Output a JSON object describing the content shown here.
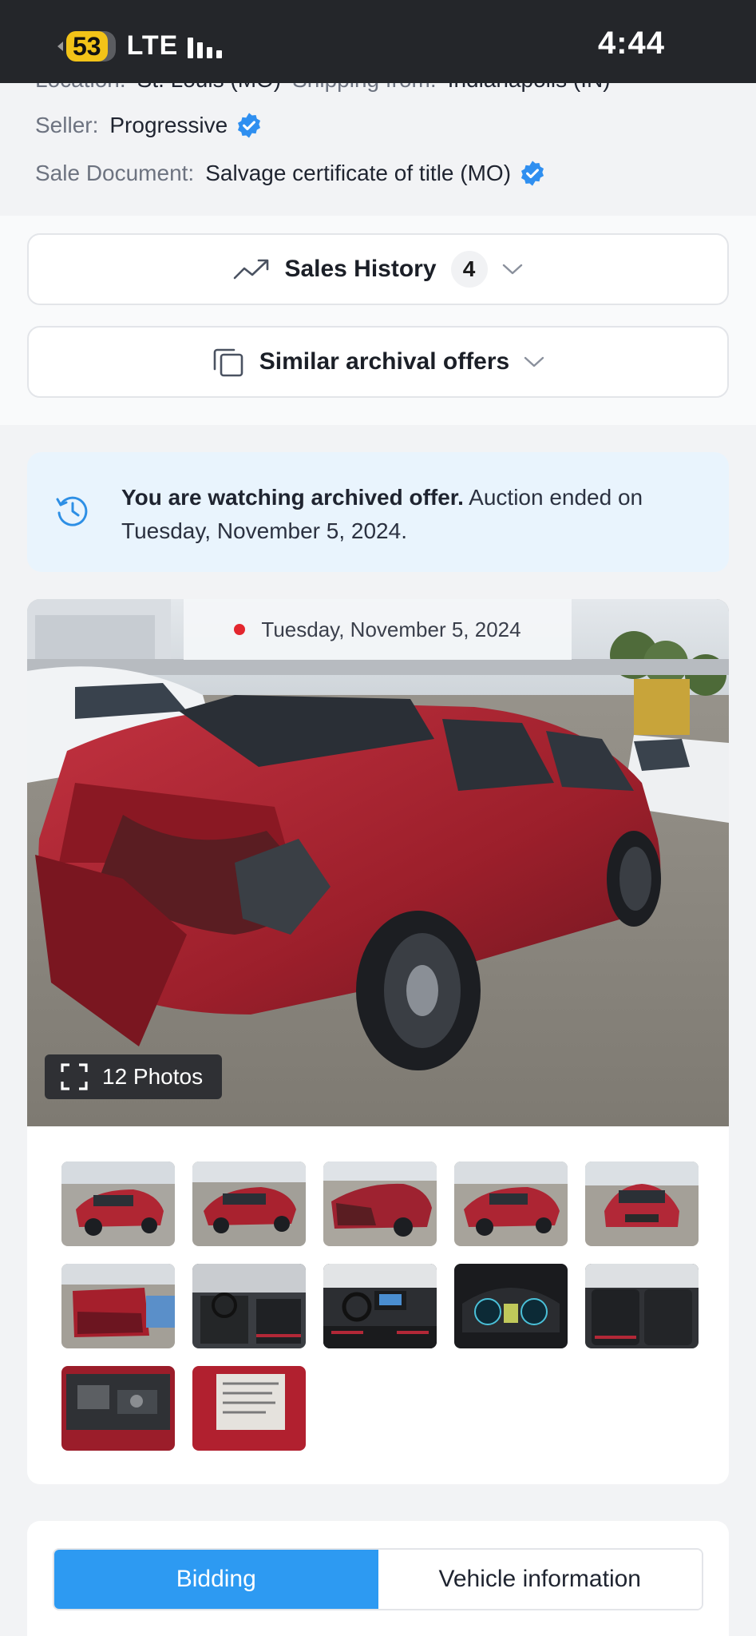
{
  "status_bar": {
    "battery": "53",
    "network": "LTE",
    "time": "4:44"
  },
  "listing": {
    "location_label": "Location:",
    "location_value": "St. Louis (MO)",
    "shipping_label": "Shipping from:",
    "shipping_value": "Indianapolis (IN)",
    "seller_label": "Seller:",
    "seller_value": "Progressive",
    "sale_document_label": "Sale Document:",
    "sale_document_value": "Salvage certificate of title (MO)"
  },
  "sections": {
    "sales_history_label": "Sales History",
    "sales_history_count": "4",
    "similar_offers_label": "Similar archival offers"
  },
  "banner": {
    "bold_text": "You are watching archived offer.",
    "text": " Auction ended on Tuesday, November 5, 2024."
  },
  "gallery": {
    "date": "Tuesday, November 5, 2024",
    "photos_button": "12 Photos",
    "photo_count": 12
  },
  "tabs": {
    "bidding": "Bidding",
    "vehicle_information": "Vehicle information",
    "active": "Bidding"
  },
  "colors": {
    "accent": "#2d9af2",
    "verified": "#2f8ff0",
    "banner_bg": "#e9f4fd",
    "car_red": "#a3222e",
    "live_dot": "#e3262e"
  },
  "icons": {
    "verified": "verified-badge-icon",
    "trend": "trending-up-icon",
    "copy": "copy-icon",
    "chevron": "chevron-down-icon",
    "history": "history-icon",
    "fullscreen": "fullscreen-icon"
  }
}
